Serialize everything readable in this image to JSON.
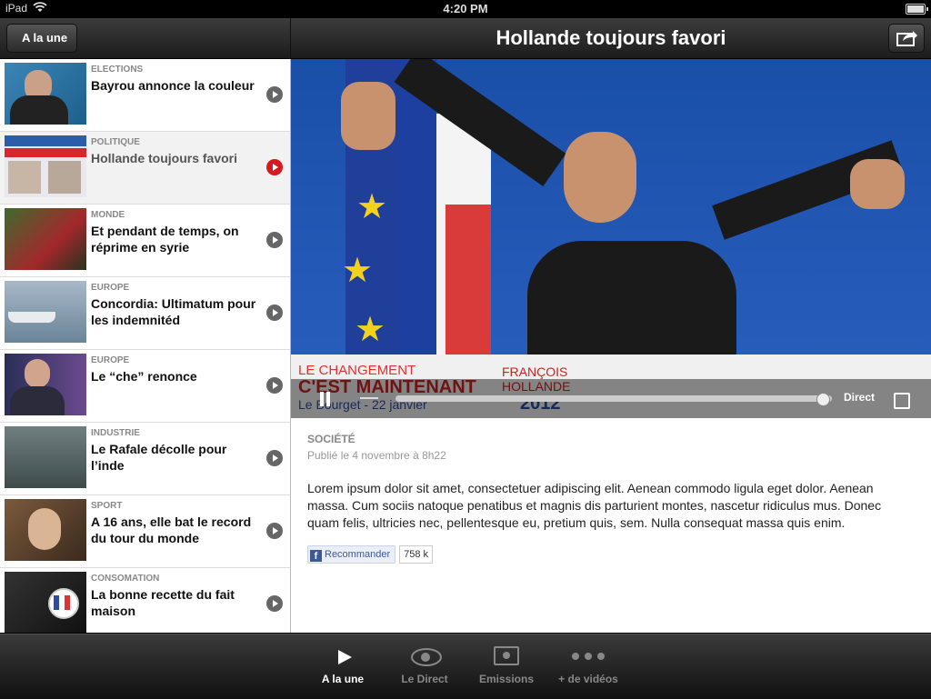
{
  "status": {
    "device": "iPad",
    "time": "4:20 PM"
  },
  "nav": {
    "back_label": "A la une",
    "title": "Hollande toujours favori"
  },
  "articles": [
    {
      "category": "ELECTIONS",
      "title": "Bayrou annonce la couleur",
      "active": false
    },
    {
      "category": "POLITIQUE",
      "title": "Hollande toujours favori",
      "active": true
    },
    {
      "category": "MONDE",
      "title": "Et pendant de temps, on réprime en syrie",
      "active": false
    },
    {
      "category": "EUROPE",
      "title": "Concordia: Ultimatum pour les indemnitéd",
      "active": false
    },
    {
      "category": "EUROPE",
      "title": "Le “che” renonce",
      "active": false
    },
    {
      "category": "INDUSTRIE",
      "title": "Le Rafale décolle pour l’inde",
      "active": false
    },
    {
      "category": "SPORT",
      "title": "A 16 ans, elle bat le record du tour du monde",
      "active": false
    },
    {
      "category": "CONSOMATION",
      "title": "La bonne recette du fait maison",
      "active": false
    }
  ],
  "video": {
    "podium_line1": "LE CHANGEMENT",
    "podium_line2": "C'EST MAINTENANT",
    "podium_line3": "Le Bourget - 22 janvier",
    "podium_name1": "FRANÇOIS",
    "podium_name2": "HOLLANDE",
    "podium_year": "2012",
    "direct_label": "Direct",
    "progress": 0.98
  },
  "article": {
    "category": "Société",
    "date": "Publié le 4 novembre à 8h22",
    "body": "Lorem ipsum dolor sit amet, consectetuer adipiscing elit. Aenean commodo ligula eget dolor. Aenean massa. Cum sociis natoque penatibus et magnis dis parturient montes, nascetur ridiculus mus. Donec quam felis, ultricies nec, pellentesque eu, pretium quis, sem. Nulla consequat massa quis enim.",
    "fb_label": "Recommander",
    "fb_count": "758 k"
  },
  "tabs": [
    {
      "label": "A la une",
      "icon": "play-icon",
      "active": true
    },
    {
      "label": "Le Direct",
      "icon": "eye-icon",
      "active": false
    },
    {
      "label": "Emissions",
      "icon": "tv-icon",
      "active": false
    },
    {
      "label": "+ de vidéos",
      "icon": "more-icon",
      "active": false
    }
  ],
  "colors": {
    "accent_red": "#d71920",
    "fb_blue": "#3b5998"
  }
}
